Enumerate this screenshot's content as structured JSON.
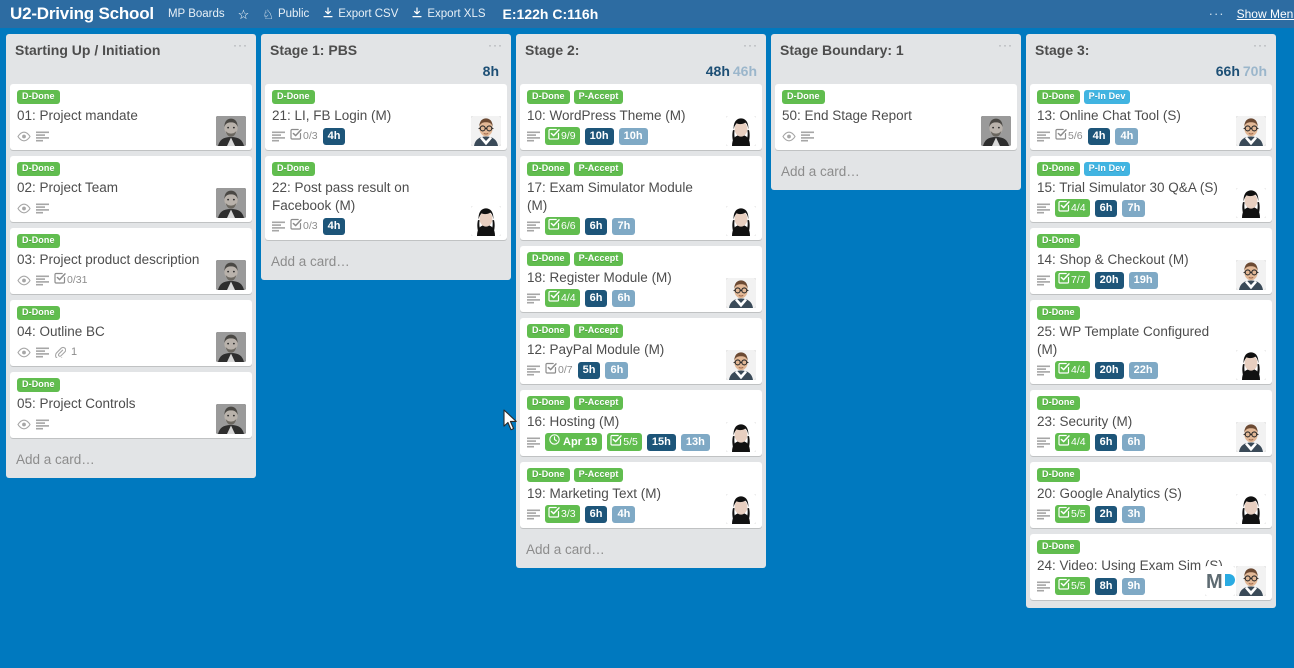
{
  "header": {
    "board_title": "U2-Driving School",
    "org_label": "MP Boards",
    "star_icon": "star-icon",
    "visibility_icon": "globe-icon",
    "visibility": "Public",
    "export_csv_icon": "download-icon",
    "export_csv": "Export CSV",
    "export_xls_icon": "download-icon",
    "export_xls": "Export XLS",
    "totals": "E:122h C:116h",
    "menu_dots": "···",
    "show_menu": "Show Menu",
    "bg_color": "#2d6ca2"
  },
  "board": {
    "background_color": "#0079bf",
    "add_card_label": "Add a card…",
    "list_dots": "···",
    "lists": [
      {
        "title": "Starting Up / Initiation",
        "hours_estimate": "",
        "hours_actual": "",
        "has_add_card": true,
        "cards": [
          {
            "title": "01: Project mandate",
            "labels": [
              {
                "text": "D-Done",
                "color": "green"
              }
            ],
            "icons": [
              "eye-icon",
              "description-icon"
            ],
            "checklist": null,
            "due": null,
            "attachments": null,
            "hours_estimate": "",
            "hours_actual": "",
            "avatars": [
              "avatar-man-grey"
            ]
          },
          {
            "title": "02: Project Team",
            "labels": [
              {
                "text": "D-Done",
                "color": "green"
              }
            ],
            "icons": [
              "eye-icon",
              "description-icon"
            ],
            "checklist": null,
            "due": null,
            "attachments": null,
            "hours_estimate": "",
            "hours_actual": "",
            "avatars": [
              "avatar-man-grey"
            ]
          },
          {
            "title": "03: Project product description",
            "labels": [
              {
                "text": "D-Done",
                "color": "green"
              }
            ],
            "icons": [
              "eye-icon",
              "description-icon"
            ],
            "checklist": {
              "text": "0/31",
              "complete": false
            },
            "due": null,
            "attachments": null,
            "hours_estimate": "",
            "hours_actual": "",
            "avatars": [
              "avatar-man-grey"
            ]
          },
          {
            "title": "04: Outline BC",
            "labels": [
              {
                "text": "D-Done",
                "color": "green"
              }
            ],
            "icons": [
              "eye-icon",
              "description-icon"
            ],
            "checklist": null,
            "due": null,
            "attachments": "1",
            "hours_estimate": "",
            "hours_actual": "",
            "avatars": [
              "avatar-man-grey"
            ]
          },
          {
            "title": "05: Project Controls",
            "labels": [
              {
                "text": "D-Done",
                "color": "green"
              }
            ],
            "icons": [
              "eye-icon",
              "description-icon"
            ],
            "checklist": null,
            "due": null,
            "attachments": null,
            "hours_estimate": "",
            "hours_actual": "",
            "avatars": [
              "avatar-man-grey"
            ]
          }
        ]
      },
      {
        "title": "Stage 1: PBS",
        "hours_estimate": "8h",
        "hours_actual": "",
        "has_add_card": true,
        "cards": [
          {
            "title": "21: LI, FB Login (M)",
            "labels": [
              {
                "text": "D-Done",
                "color": "green"
              }
            ],
            "icons": [
              "description-icon"
            ],
            "checklist": {
              "text": "0/3",
              "complete": false
            },
            "due": null,
            "attachments": null,
            "hours_estimate": "4h",
            "hours_actual": "",
            "avatars": [
              "avatar-man-glasses"
            ]
          },
          {
            "title": "22: Post pass result on Facebook (M)",
            "labels": [
              {
                "text": "D-Done",
                "color": "green"
              }
            ],
            "icons": [
              "description-icon"
            ],
            "checklist": {
              "text": "0/3",
              "complete": false
            },
            "due": null,
            "attachments": null,
            "hours_estimate": "4h",
            "hours_actual": "",
            "avatars": [
              "avatar-woman-dark"
            ]
          }
        ]
      },
      {
        "title": "Stage 2:",
        "hours_estimate": "48h",
        "hours_actual": "46h",
        "has_add_card": true,
        "cards": [
          {
            "title": "10: WordPress Theme (M)",
            "labels": [
              {
                "text": "D-Done",
                "color": "green"
              },
              {
                "text": "P-Accept",
                "color": "green"
              }
            ],
            "icons": [
              "description-icon"
            ],
            "checklist": {
              "text": "9/9",
              "complete": true
            },
            "due": null,
            "attachments": null,
            "hours_estimate": "10h",
            "hours_actual": "10h",
            "avatars": [
              "avatar-woman-dark"
            ]
          },
          {
            "title": "17: Exam Simulator Module (M)",
            "labels": [
              {
                "text": "D-Done",
                "color": "green"
              },
              {
                "text": "P-Accept",
                "color": "green"
              }
            ],
            "icons": [
              "description-icon"
            ],
            "checklist": {
              "text": "6/6",
              "complete": true
            },
            "due": null,
            "attachments": null,
            "hours_estimate": "6h",
            "hours_actual": "7h",
            "avatars": [
              "avatar-woman-dark"
            ]
          },
          {
            "title": "18: Register Module (M)",
            "labels": [
              {
                "text": "D-Done",
                "color": "green"
              },
              {
                "text": "P-Accept",
                "color": "green"
              }
            ],
            "icons": [
              "description-icon"
            ],
            "checklist": {
              "text": "4/4",
              "complete": true
            },
            "due": null,
            "attachments": null,
            "hours_estimate": "6h",
            "hours_actual": "6h",
            "avatars": [
              "avatar-man-glasses"
            ]
          },
          {
            "title": "12: PayPal Module (M)",
            "labels": [
              {
                "text": "D-Done",
                "color": "green"
              },
              {
                "text": "P-Accept",
                "color": "green"
              }
            ],
            "icons": [
              "description-icon"
            ],
            "checklist": {
              "text": "0/7",
              "complete": false
            },
            "due": null,
            "attachments": null,
            "hours_estimate": "5h",
            "hours_actual": "6h",
            "avatars": [
              "avatar-man-glasses"
            ]
          },
          {
            "title": "16: Hosting (M)",
            "labels": [
              {
                "text": "D-Done",
                "color": "green"
              },
              {
                "text": "P-Accept",
                "color": "green"
              }
            ],
            "icons": [
              "description-icon"
            ],
            "checklist": {
              "text": "5/5",
              "complete": true
            },
            "due": "Apr 19",
            "attachments": null,
            "hours_estimate": "15h",
            "hours_actual": "13h",
            "avatars": [
              "avatar-woman-dark"
            ]
          },
          {
            "title": "19: Marketing Text (M)",
            "labels": [
              {
                "text": "D-Done",
                "color": "green"
              },
              {
                "text": "P-Accept",
                "color": "green"
              }
            ],
            "icons": [
              "description-icon"
            ],
            "checklist": {
              "text": "3/3",
              "complete": true
            },
            "due": null,
            "attachments": null,
            "hours_estimate": "6h",
            "hours_actual": "4h",
            "avatars": [
              "avatar-woman-dark"
            ]
          }
        ]
      },
      {
        "title": "Stage Boundary: 1",
        "hours_estimate": "",
        "hours_actual": "",
        "has_add_card": true,
        "cards": [
          {
            "title": "50: End Stage Report",
            "labels": [
              {
                "text": "D-Done",
                "color": "green"
              }
            ],
            "icons": [
              "eye-icon",
              "description-icon"
            ],
            "checklist": null,
            "due": null,
            "attachments": null,
            "hours_estimate": "",
            "hours_actual": "",
            "avatars": [
              "avatar-man-grey"
            ]
          }
        ]
      },
      {
        "title": "Stage 3:",
        "hours_estimate": "66h",
        "hours_actual": "70h",
        "has_add_card": false,
        "cards": [
          {
            "title": "13: Online Chat Tool (S)",
            "labels": [
              {
                "text": "D-Done",
                "color": "green"
              },
              {
                "text": "P-In Dev",
                "color": "blue"
              }
            ],
            "icons": [
              "description-icon"
            ],
            "checklist": {
              "text": "5/6",
              "complete": false
            },
            "due": null,
            "attachments": null,
            "hours_estimate": "4h",
            "hours_actual": "4h",
            "avatars": [
              "avatar-man-glasses"
            ]
          },
          {
            "title": "15: Trial Simulator 30 Q&A (S)",
            "labels": [
              {
                "text": "D-Done",
                "color": "green"
              },
              {
                "text": "P-In Dev",
                "color": "blue"
              }
            ],
            "icons": [
              "description-icon"
            ],
            "checklist": {
              "text": "4/4",
              "complete": true
            },
            "due": null,
            "attachments": null,
            "hours_estimate": "6h",
            "hours_actual": "7h",
            "avatars": [
              "avatar-woman-dark"
            ]
          },
          {
            "title": "14: Shop & Checkout (M)",
            "labels": [
              {
                "text": "D-Done",
                "color": "green"
              }
            ],
            "icons": [
              "description-icon"
            ],
            "checklist": {
              "text": "7/7",
              "complete": true
            },
            "due": null,
            "attachments": null,
            "hours_estimate": "20h",
            "hours_actual": "19h",
            "avatars": [
              "avatar-man-glasses"
            ]
          },
          {
            "title": "25: WP Template Configured (M)",
            "labels": [
              {
                "text": "D-Done",
                "color": "green"
              }
            ],
            "icons": [
              "description-icon"
            ],
            "checklist": {
              "text": "4/4",
              "complete": true
            },
            "due": null,
            "attachments": null,
            "hours_estimate": "20h",
            "hours_actual": "22h",
            "avatars": [
              "avatar-woman-dark"
            ]
          },
          {
            "title": "23: Security (M)",
            "labels": [
              {
                "text": "D-Done",
                "color": "green"
              }
            ],
            "icons": [
              "description-icon"
            ],
            "checklist": {
              "text": "4/4",
              "complete": true
            },
            "due": null,
            "attachments": null,
            "hours_estimate": "6h",
            "hours_actual": "6h",
            "avatars": [
              "avatar-man-glasses"
            ]
          },
          {
            "title": "20: Google Analytics (S)",
            "labels": [
              {
                "text": "D-Done",
                "color": "green"
              }
            ],
            "icons": [
              "description-icon"
            ],
            "checklist": {
              "text": "5/5",
              "complete": true
            },
            "due": null,
            "attachments": null,
            "hours_estimate": "2h",
            "hours_actual": "3h",
            "avatars": [
              "avatar-woman-dark"
            ]
          },
          {
            "title": "24: Video: Using Exam Sim (S)",
            "labels": [
              {
                "text": "D-Done",
                "color": "green"
              }
            ],
            "icons": [
              "description-icon"
            ],
            "checklist": {
              "text": "5/5",
              "complete": true
            },
            "due": null,
            "attachments": null,
            "hours_estimate": "8h",
            "hours_actual": "9h",
            "avatars": [
              "avatar-mp-logo",
              "avatar-man-glasses"
            ]
          }
        ]
      }
    ]
  }
}
